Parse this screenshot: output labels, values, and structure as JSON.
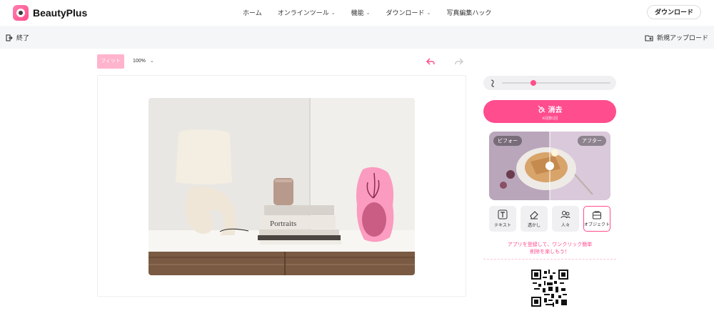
{
  "app": {
    "name": "BeautyPlus"
  },
  "nav": {
    "items": [
      {
        "label": "ホーム",
        "dropdown": false
      },
      {
        "label": "オンラインツール",
        "dropdown": true
      },
      {
        "label": "機能",
        "dropdown": true
      },
      {
        "label": "ダウンロード",
        "dropdown": true
      },
      {
        "label": "写真編集ハック",
        "dropdown": false
      }
    ],
    "download_button": "ダウンロード"
  },
  "subbar": {
    "exit_label": "終了",
    "new_upload_label": "新規アップロード"
  },
  "toolbar": {
    "fit_label": "フィット",
    "zoom_value": "100%"
  },
  "panel": {
    "erase_title": "消去",
    "erase_subtitle": "※回数1回",
    "compare": {
      "before_label": "ビフォー",
      "after_label": "アフター"
    },
    "tools": [
      {
        "label": "テキスト",
        "icon": "text-icon",
        "active": false
      },
      {
        "label": "透かし",
        "icon": "eraser-icon",
        "active": false
      },
      {
        "label": "人々",
        "icon": "people-icon",
        "active": false
      },
      {
        "label": "オブジェクト",
        "icon": "object-icon",
        "active": true
      }
    ],
    "promo_line1": "アプリを登録して、ワンクリック簡単",
    "promo_line2": "削除を楽しもう！"
  },
  "colors": {
    "accent": "#ff4d8d",
    "accent_light": "#ffb3cc",
    "subbar_bg": "#f5f6f8"
  }
}
